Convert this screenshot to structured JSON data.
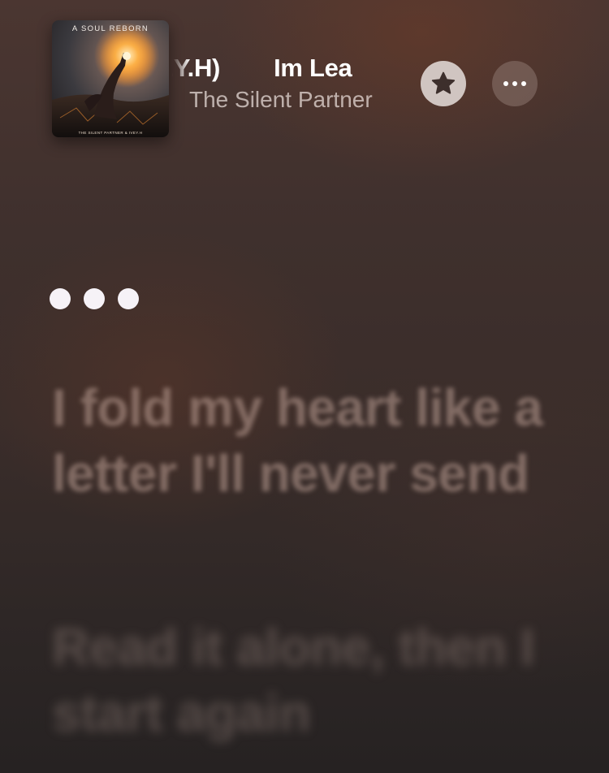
{
  "now_playing": {
    "artwork": {
      "title": "A SOUL REBORN",
      "credit": "THE SILENT PARTNER & IVEY.H"
    },
    "song_title_scroll": ". IVEY.H)",
    "song_title_next": "Im Lea",
    "artist": "The Silent Partner",
    "icons": {
      "favorite": "star-icon",
      "more": "more-icon"
    }
  },
  "lyrics": {
    "waiting_indicator": "ellipsis",
    "next_line": "I fold my heart like a letter I'll never send",
    "later_line": "Read it alone, then I start again"
  },
  "colors": {
    "background_top": "#4b3631",
    "background_bottom": "#262222",
    "favorite_button_bg": "#e1dad6",
    "more_button_bg": "#8c7670"
  }
}
